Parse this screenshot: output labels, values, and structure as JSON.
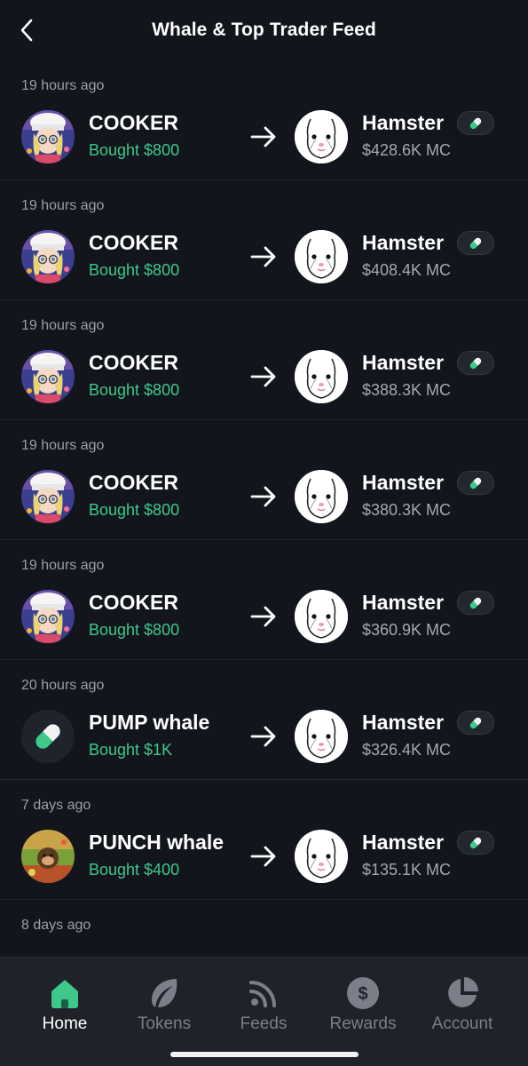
{
  "header": {
    "title": "Whale & Top Trader Feed"
  },
  "feed": [
    {
      "time": "19 hours ago",
      "trader": "COOKER",
      "action": "Bought $800",
      "trader_avatar": "anime-chef-avatar",
      "token": "Hamster",
      "mc": "$428.6K MC"
    },
    {
      "time": "19 hours ago",
      "trader": "COOKER",
      "action": "Bought $800",
      "trader_avatar": "anime-chef-avatar",
      "token": "Hamster",
      "mc": "$408.4K MC"
    },
    {
      "time": "19 hours ago",
      "trader": "COOKER",
      "action": "Bought $800",
      "trader_avatar": "anime-chef-avatar",
      "token": "Hamster",
      "mc": "$388.3K MC"
    },
    {
      "time": "19 hours ago",
      "trader": "COOKER",
      "action": "Bought $800",
      "trader_avatar": "anime-chef-avatar",
      "token": "Hamster",
      "mc": "$380.3K MC"
    },
    {
      "time": "19 hours ago",
      "trader": "COOKER",
      "action": "Bought $800",
      "trader_avatar": "anime-chef-avatar",
      "token": "Hamster",
      "mc": "$360.9K MC"
    },
    {
      "time": "20 hours ago",
      "trader": "PUMP whale",
      "action": "Bought $1K",
      "trader_avatar": "pill-icon",
      "token": "Hamster",
      "mc": "$326.4K MC"
    },
    {
      "time": "7 days ago",
      "trader": "PUNCH whale",
      "action": "Bought $400",
      "trader_avatar": "monkey-avatar",
      "token": "Hamster",
      "mc": "$135.1K MC"
    }
  ],
  "partial": {
    "time": "8 days ago"
  },
  "nav": [
    {
      "label": "Home",
      "icon": "home-icon",
      "active": true
    },
    {
      "label": "Tokens",
      "icon": "leaf-icon",
      "active": false
    },
    {
      "label": "Feeds",
      "icon": "feed-icon",
      "active": false
    },
    {
      "label": "Rewards",
      "icon": "dollar-coin-icon",
      "active": false
    },
    {
      "label": "Account",
      "icon": "pie-chart-icon",
      "active": false
    }
  ],
  "colors": {
    "background": "#12151c",
    "accent_green": "#3ec98b",
    "muted": "#9a9ea8"
  }
}
